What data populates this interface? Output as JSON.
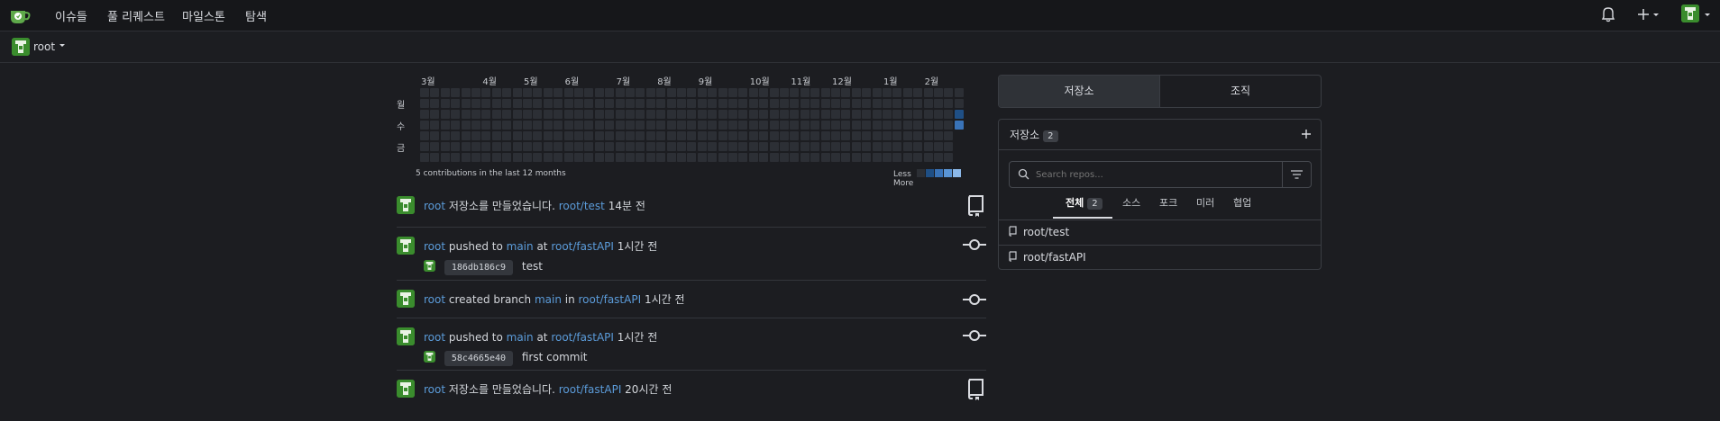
{
  "nav": {
    "items": [
      "이슈들",
      "풀 리퀘스트",
      "마일스톤",
      "탐색"
    ],
    "logo": "gitea-logo-icon",
    "right_icons": [
      "bell-icon",
      "plus-icon",
      "caret-down-icon",
      "user-avatar"
    ]
  },
  "context": {
    "user": "root",
    "icon": "caret-down-icon"
  },
  "heatmap": {
    "months": [
      "3월",
      "4월",
      "5월",
      "6월",
      "7월",
      "8월",
      "9월",
      "10월",
      "11월",
      "12월",
      "1월",
      "2월"
    ],
    "days": [
      "월",
      "수",
      "금"
    ],
    "summary": "5 contributions in the last 12 months",
    "legend_less": "Less",
    "legend_more": "More",
    "colors": {
      "empty": "#2c2f35",
      "low": "#1f4f85",
      "mid": "#3973b8",
      "high": "#5a95d6",
      "max": "#8cb9ea"
    }
  },
  "feed": [
    {
      "user": "root",
      "text1": " 저장소를 만들었습니다. ",
      "link1": "root/test",
      "text2": "",
      "link2": "",
      "time": " 14분 전",
      "icon": "repo-icon"
    },
    {
      "user": "root",
      "text1": " pushed to ",
      "link1": "main",
      "text2": " at ",
      "link2": "root/fastAPI",
      "time": " 1시간 전",
      "icon": "commit-icon",
      "sha": "186db186c9",
      "message": "test"
    },
    {
      "user": "root",
      "text1": " created branch ",
      "link1": "main",
      "text2": " in ",
      "link2": "root/fastAPI",
      "time": " 1시간 전",
      "icon": "commit-icon"
    },
    {
      "user": "root",
      "text1": " pushed to ",
      "link1": "main",
      "text2": " at ",
      "link2": "root/fastAPI",
      "time": " 1시간 전",
      "icon": "commit-icon",
      "sha": "58c4665e40",
      "message": "first commit"
    },
    {
      "user": "root",
      "text1": " 저장소를 만들었습니다. ",
      "link1": "root/fastAPI",
      "text2": "",
      "link2": "",
      "time": " 20시간 전",
      "icon": "repo-icon"
    }
  ],
  "panel": {
    "tabs": [
      "저장소",
      "조직"
    ],
    "header": "저장소",
    "count": "2",
    "add_icon": "plus-icon",
    "search_placeholder": "Search repos...",
    "filter_icon": "filter-icon",
    "filters": [
      "전체",
      "소스",
      "포크",
      "미러",
      "협업"
    ],
    "all_count": "2",
    "repos": [
      "root/test",
      "root/fastAPI"
    ]
  }
}
